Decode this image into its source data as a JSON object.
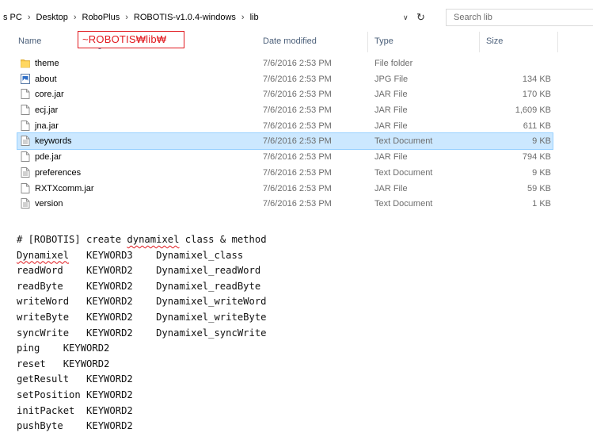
{
  "breadcrumbs": [
    "s PC",
    "Desktop",
    "RoboPlus",
    "ROBOTIS-v1.0.4-windows",
    "lib"
  ],
  "search": {
    "placeholder": "Search lib"
  },
  "columns": {
    "name": "Name",
    "date": "Date modified",
    "type": "Type",
    "size": "Size"
  },
  "callout": {
    "text": "~ROBOTIS₩lib₩"
  },
  "files": [
    {
      "name": "theme",
      "date": "7/6/2016 2:53 PM",
      "type": "File folder",
      "size": "",
      "icon": "folder-icon"
    },
    {
      "name": "about",
      "date": "7/6/2016 2:53 PM",
      "type": "JPG File",
      "size": "134 KB",
      "icon": "image-file-icon"
    },
    {
      "name": "core.jar",
      "date": "7/6/2016 2:53 PM",
      "type": "JAR File",
      "size": "170 KB",
      "icon": "file-icon"
    },
    {
      "name": "ecj.jar",
      "date": "7/6/2016 2:53 PM",
      "type": "JAR File",
      "size": "1,609 KB",
      "icon": "file-icon"
    },
    {
      "name": "jna.jar",
      "date": "7/6/2016 2:53 PM",
      "type": "JAR File",
      "size": "611 KB",
      "icon": "file-icon"
    },
    {
      "name": "keywords",
      "date": "7/6/2016 2:53 PM",
      "type": "Text Document",
      "size": "9 KB",
      "icon": "text-file-icon",
      "selected": true
    },
    {
      "name": "pde.jar",
      "date": "7/6/2016 2:53 PM",
      "type": "JAR File",
      "size": "794 KB",
      "icon": "file-icon"
    },
    {
      "name": "preferences",
      "date": "7/6/2016 2:53 PM",
      "type": "Text Document",
      "size": "9 KB",
      "icon": "text-file-icon"
    },
    {
      "name": "RXTXcomm.jar",
      "date": "7/6/2016 2:53 PM",
      "type": "JAR File",
      "size": "59 KB",
      "icon": "file-icon"
    },
    {
      "name": "version",
      "date": "7/6/2016 2:53 PM",
      "type": "Text Document",
      "size": "1 KB",
      "icon": "text-file-icon"
    }
  ],
  "code_lines": [
    "# [ROBOTIS] create dynamixel class & method",
    "Dynamixel   KEYWORD3    Dynamixel_class",
    "readWord    KEYWORD2    Dynamixel_readWord",
    "readByte    KEYWORD2    Dynamixel_readByte",
    "writeWord   KEYWORD2    Dynamixel_writeWord",
    "writeByte   KEYWORD2    Dynamixel_writeByte",
    "syncWrite   KEYWORD2    Dynamixel_syncWrite",
    "ping    KEYWORD2",
    "reset   KEYWORD2",
    "getResult   KEYWORD2",
    "setPosition KEYWORD2",
    "initPacket  KEYWORD2",
    "pushByte    KEYWORD2"
  ],
  "colors": {
    "selection": "#cce8ff",
    "callout": "#e1191e",
    "header_text": "#4c607a"
  }
}
